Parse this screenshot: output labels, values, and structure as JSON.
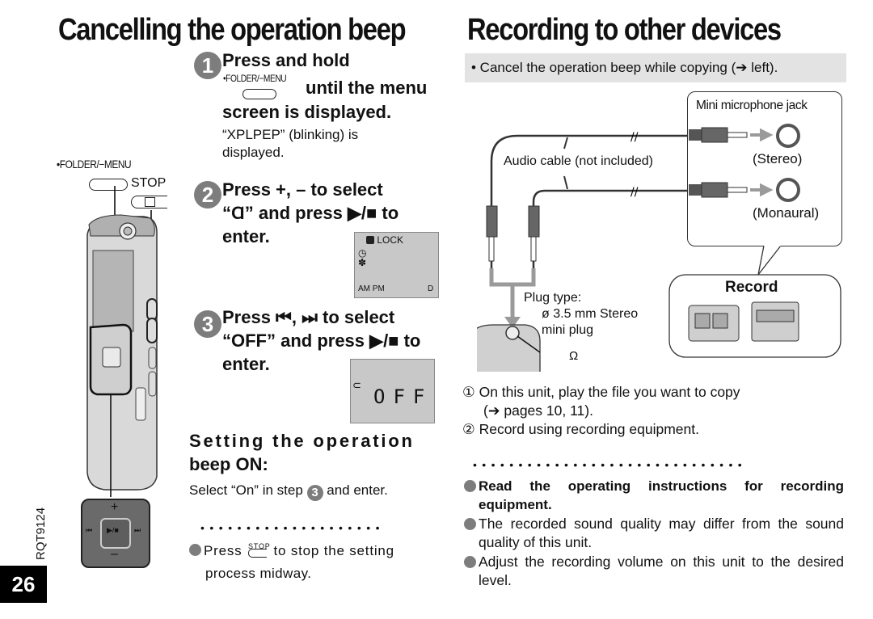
{
  "left": {
    "title": "Cancelling the operation beep",
    "button_labels": {
      "folder_menu": "•FOLDER/−MENU",
      "stop": "STOP"
    },
    "steps": [
      {
        "number": "1",
        "title_line1": "Press and hold",
        "title_line2": "until the menu",
        "title_line3": "screen is displayed.",
        "inline_button_label": "•FOLDER/−MENU",
        "note_line1": "“XPLPEP” (blinking) is",
        "note_line2": "displayed."
      },
      {
        "number": "2",
        "title_line1": "Press +, – to select",
        "title_line2": "“Ɑ” and press ▶/■ to",
        "title_line3": "enter.",
        "lcd": {
          "lock_label": "LOCK",
          "footer_left": "AM PM",
          "footer_right": "D"
        }
      },
      {
        "number": "3",
        "title_line1": "Press ⏮, ⏭ to select",
        "title_line2": "“OFF” and press ▶/■ to",
        "title_line3": "enter.",
        "lcd": {
          "segment_text": "OFF"
        }
      }
    ],
    "beep_on": {
      "heading_line1": "Setting the operation",
      "heading_line2": "beep ON:",
      "text_prefix": "Select “On” in step",
      "step_ref": "3",
      "text_suffix": "and enter."
    },
    "dots": "••••••••••••••••••••",
    "note": {
      "prefix": "Press",
      "button_label": "STOP",
      "suffix": "to stop the setting",
      "line2": "process midway."
    },
    "device_buttons": {
      "plus": "+",
      "minus": "–",
      "prev": "⏮",
      "next": "⏭",
      "play_stop": "▶/■"
    }
  },
  "right": {
    "title": "Recording to other devices",
    "tip": "• Cancel the operation beep while copying (➔ left).",
    "diagram": {
      "jack_box_title": "Mini microphone jack",
      "cable_label": "Audio cable (not included)",
      "stereo_label": "(Stereo)",
      "mono_label": "(Monaural)",
      "plug_type_line1": "Plug type:",
      "plug_type_line2": "ø 3.5 mm Stereo",
      "plug_type_line3": "mini plug",
      "headphone_symbol": "Ω",
      "record_label": "Record"
    },
    "instructions": [
      {
        "marker": "①",
        "line1": "On this unit, play the file you want to copy",
        "line2": "(➔ pages 10, 11)."
      },
      {
        "marker": "②",
        "line1": "Record using recording equipment."
      }
    ],
    "dots": "••••••••••••••••••••••••••••••",
    "notes": [
      {
        "text": "Read the operating instructions for recording equipment.",
        "bold": true
      },
      {
        "text": "The recorded sound quality may differ from the sound quality of this unit.",
        "bold": false
      },
      {
        "text": "Adjust the recording volume on this unit to the desired level.",
        "bold": false
      }
    ]
  },
  "footer": {
    "doc_code": "RQT9124",
    "page_number": "26"
  },
  "colors": {
    "step_circle": "#7d7d7d",
    "tip_bar": "#e3e3e3",
    "lcd": "#c8c8c8",
    "arrow": "#9a9a9a"
  }
}
